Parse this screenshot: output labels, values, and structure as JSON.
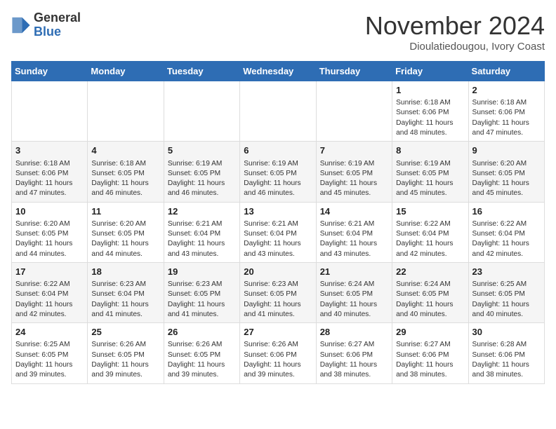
{
  "header": {
    "logo_general": "General",
    "logo_blue": "Blue",
    "month_title": "November 2024",
    "location": "Dioulatiedougou, Ivory Coast"
  },
  "days_of_week": [
    "Sunday",
    "Monday",
    "Tuesday",
    "Wednesday",
    "Thursday",
    "Friday",
    "Saturday"
  ],
  "weeks": [
    [
      {
        "day": "",
        "info": ""
      },
      {
        "day": "",
        "info": ""
      },
      {
        "day": "",
        "info": ""
      },
      {
        "day": "",
        "info": ""
      },
      {
        "day": "",
        "info": ""
      },
      {
        "day": "1",
        "info": "Sunrise: 6:18 AM\nSunset: 6:06 PM\nDaylight: 11 hours\nand 48 minutes."
      },
      {
        "day": "2",
        "info": "Sunrise: 6:18 AM\nSunset: 6:06 PM\nDaylight: 11 hours\nand 47 minutes."
      }
    ],
    [
      {
        "day": "3",
        "info": "Sunrise: 6:18 AM\nSunset: 6:06 PM\nDaylight: 11 hours\nand 47 minutes."
      },
      {
        "day": "4",
        "info": "Sunrise: 6:18 AM\nSunset: 6:05 PM\nDaylight: 11 hours\nand 46 minutes."
      },
      {
        "day": "5",
        "info": "Sunrise: 6:19 AM\nSunset: 6:05 PM\nDaylight: 11 hours\nand 46 minutes."
      },
      {
        "day": "6",
        "info": "Sunrise: 6:19 AM\nSunset: 6:05 PM\nDaylight: 11 hours\nand 46 minutes."
      },
      {
        "day": "7",
        "info": "Sunrise: 6:19 AM\nSunset: 6:05 PM\nDaylight: 11 hours\nand 45 minutes."
      },
      {
        "day": "8",
        "info": "Sunrise: 6:19 AM\nSunset: 6:05 PM\nDaylight: 11 hours\nand 45 minutes."
      },
      {
        "day": "9",
        "info": "Sunrise: 6:20 AM\nSunset: 6:05 PM\nDaylight: 11 hours\nand 45 minutes."
      }
    ],
    [
      {
        "day": "10",
        "info": "Sunrise: 6:20 AM\nSunset: 6:05 PM\nDaylight: 11 hours\nand 44 minutes."
      },
      {
        "day": "11",
        "info": "Sunrise: 6:20 AM\nSunset: 6:05 PM\nDaylight: 11 hours\nand 44 minutes."
      },
      {
        "day": "12",
        "info": "Sunrise: 6:21 AM\nSunset: 6:04 PM\nDaylight: 11 hours\nand 43 minutes."
      },
      {
        "day": "13",
        "info": "Sunrise: 6:21 AM\nSunset: 6:04 PM\nDaylight: 11 hours\nand 43 minutes."
      },
      {
        "day": "14",
        "info": "Sunrise: 6:21 AM\nSunset: 6:04 PM\nDaylight: 11 hours\nand 43 minutes."
      },
      {
        "day": "15",
        "info": "Sunrise: 6:22 AM\nSunset: 6:04 PM\nDaylight: 11 hours\nand 42 minutes."
      },
      {
        "day": "16",
        "info": "Sunrise: 6:22 AM\nSunset: 6:04 PM\nDaylight: 11 hours\nand 42 minutes."
      }
    ],
    [
      {
        "day": "17",
        "info": "Sunrise: 6:22 AM\nSunset: 6:04 PM\nDaylight: 11 hours\nand 42 minutes."
      },
      {
        "day": "18",
        "info": "Sunrise: 6:23 AM\nSunset: 6:04 PM\nDaylight: 11 hours\nand 41 minutes."
      },
      {
        "day": "19",
        "info": "Sunrise: 6:23 AM\nSunset: 6:05 PM\nDaylight: 11 hours\nand 41 minutes."
      },
      {
        "day": "20",
        "info": "Sunrise: 6:23 AM\nSunset: 6:05 PM\nDaylight: 11 hours\nand 41 minutes."
      },
      {
        "day": "21",
        "info": "Sunrise: 6:24 AM\nSunset: 6:05 PM\nDaylight: 11 hours\nand 40 minutes."
      },
      {
        "day": "22",
        "info": "Sunrise: 6:24 AM\nSunset: 6:05 PM\nDaylight: 11 hours\nand 40 minutes."
      },
      {
        "day": "23",
        "info": "Sunrise: 6:25 AM\nSunset: 6:05 PM\nDaylight: 11 hours\nand 40 minutes."
      }
    ],
    [
      {
        "day": "24",
        "info": "Sunrise: 6:25 AM\nSunset: 6:05 PM\nDaylight: 11 hours\nand 39 minutes."
      },
      {
        "day": "25",
        "info": "Sunrise: 6:26 AM\nSunset: 6:05 PM\nDaylight: 11 hours\nand 39 minutes."
      },
      {
        "day": "26",
        "info": "Sunrise: 6:26 AM\nSunset: 6:05 PM\nDaylight: 11 hours\nand 39 minutes."
      },
      {
        "day": "27",
        "info": "Sunrise: 6:26 AM\nSunset: 6:06 PM\nDaylight: 11 hours\nand 39 minutes."
      },
      {
        "day": "28",
        "info": "Sunrise: 6:27 AM\nSunset: 6:06 PM\nDaylight: 11 hours\nand 38 minutes."
      },
      {
        "day": "29",
        "info": "Sunrise: 6:27 AM\nSunset: 6:06 PM\nDaylight: 11 hours\nand 38 minutes."
      },
      {
        "day": "30",
        "info": "Sunrise: 6:28 AM\nSunset: 6:06 PM\nDaylight: 11 hours\nand 38 minutes."
      }
    ]
  ]
}
